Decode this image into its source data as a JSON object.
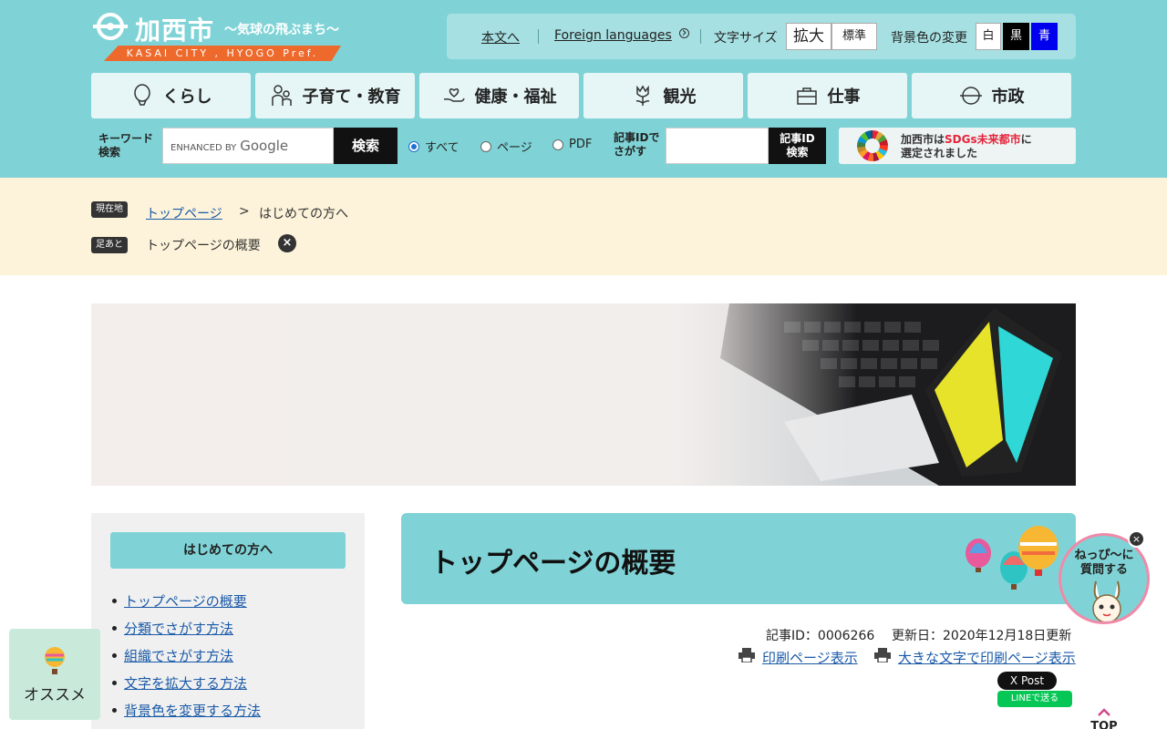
{
  "header": {
    "logo_name": "加西市",
    "logo_tagline": "〜気球の飛ぶまち〜",
    "logo_band": "KASAI CITY , HYOGO Pref."
  },
  "utility": {
    "skip_main": "本文へ",
    "foreign": "Foreign languages",
    "font_size_label": "文字サイズ",
    "font_enlarge": "拡大",
    "font_standard": "標準",
    "bg_label": "背景色の変更",
    "bg_white": "白",
    "bg_black": "黒",
    "bg_blue": "青"
  },
  "nav": [
    {
      "label": "くらし",
      "icon": "balloon-icon"
    },
    {
      "label": "子育て・教育",
      "icon": "family-icon"
    },
    {
      "label": "健康・福祉",
      "icon": "hand-heart-icon"
    },
    {
      "label": "観光",
      "icon": "tulip-icon"
    },
    {
      "label": "仕事",
      "icon": "briefcase-icon"
    },
    {
      "label": "市政",
      "icon": "city-emblem-icon"
    }
  ],
  "search": {
    "keyword_label_1": "キーワード",
    "keyword_label_2": "検索",
    "enhanced_by": "ENHANCED BY",
    "google": "Google",
    "button": "検索",
    "options": [
      "すべて",
      "ページ",
      "PDF"
    ],
    "selected": "すべて",
    "id_label_1": "記事IDで",
    "id_label_2": "さがす",
    "id_button_1": "記事ID",
    "id_button_2": "検索"
  },
  "sdgs": {
    "line1_pre": "加西市は",
    "line1_em": "SDGs未来都市",
    "line1_post": "に",
    "line2": "選定されました"
  },
  "breadcrumb": {
    "current_tag": "現在地",
    "home": "トップページ",
    "separator": ">",
    "current": "はじめての方へ",
    "history_tag": "足あと",
    "history_item": "トップページの概要",
    "close": "×"
  },
  "sidebar": {
    "heading": "はじめての方へ",
    "items": [
      "トップページの概要",
      "分類でさがす方法",
      "組織でさがす方法",
      "文字を拡大する方法",
      "背景色を変更する方法"
    ]
  },
  "article": {
    "title": "トップページの概要",
    "id_text": "記事ID：0006266",
    "updated": "更新日：2020年12月18日更新",
    "print": "印刷ページ表示",
    "print_large": "大きな文字で印刷ページ表示",
    "x_post": "X Post",
    "line_send": "LINEで送る"
  },
  "floating": {
    "osusume": "オススメ",
    "chat_line1": "ねっぴ〜に",
    "chat_line2": "質問する",
    "close": "×",
    "top": "TOP"
  },
  "colors": {
    "header_bg": "#7fd3d6",
    "crumb_bg": "#fdf3da",
    "link": "#1a5aa8",
    "band_orange": "#ee6a2c"
  }
}
